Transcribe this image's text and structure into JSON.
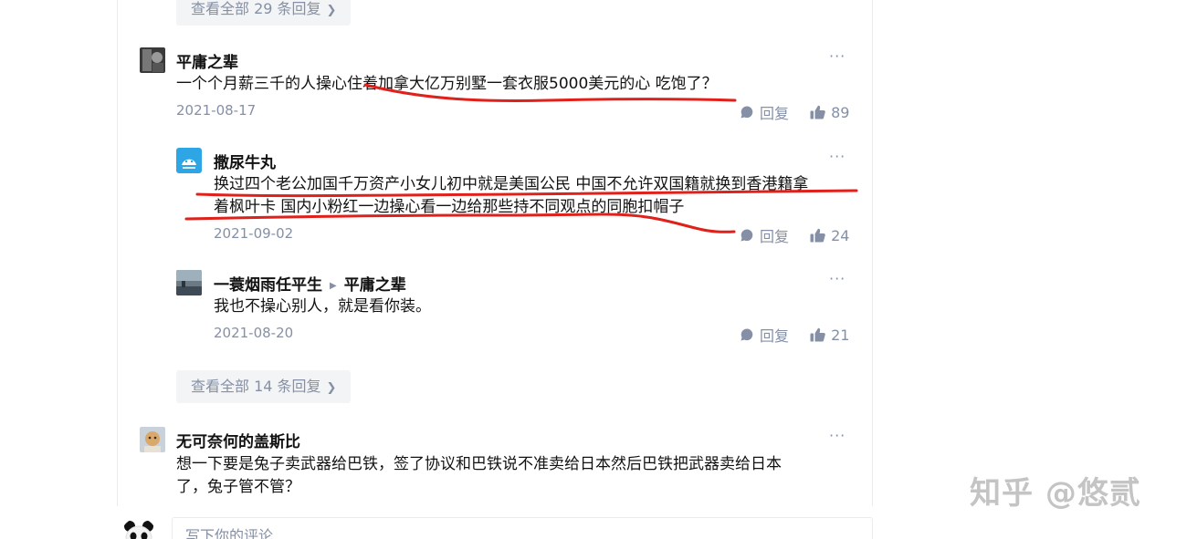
{
  "thread_top": {
    "view_all_label": "查看全部 29 条回复"
  },
  "comments": [
    {
      "author": "平庸之辈",
      "text": "一个个月薪三千的人操心住着加拿大亿万别墅一套衣服5000美元的心 吃饱了？",
      "date": "2021-08-17",
      "reply_label": "回复",
      "likes": "89",
      "more": "···"
    },
    {
      "author": "撒尿牛丸",
      "text_line1": "换过四个老公加国千万资产小女儿初中就是美国公民 中国不允许双国籍就换到香港籍拿",
      "text_line2": "着枫叶卡 国内小粉红一边操心看一边给那些持不同观点的同胞扣帽子",
      "date": "2021-09-02",
      "reply_label": "回复",
      "likes": "24",
      "more": "···"
    },
    {
      "author": "一蓑烟雨任平生",
      "reply_to": "平庸之辈",
      "text": "我也不操心别人，就是看你装。",
      "date": "2021-08-20",
      "reply_label": "回复",
      "likes": "21",
      "more": "···"
    },
    {
      "author": "无可奈何的盖斯比",
      "text_line1": "想一下要是兔子卖武器给巴铁，签了协议和巴铁说不准卖给日本然后巴铁把武器卖给日本",
      "text_line2": "了，兔子管不管？",
      "more": "···"
    }
  ],
  "thread_mid": {
    "view_all_label": "查看全部 14 条回复"
  },
  "composer": {
    "placeholder": "写下你的评论..."
  },
  "watermark": "知乎 @悠贰",
  "colors": {
    "annotation": "#e0201a",
    "meta": "#8590a6",
    "text": "#121212"
  },
  "icons": [
    "chevron-right-icon",
    "comment-bubble-icon",
    "thumbs-up-icon",
    "more-dots-icon"
  ]
}
